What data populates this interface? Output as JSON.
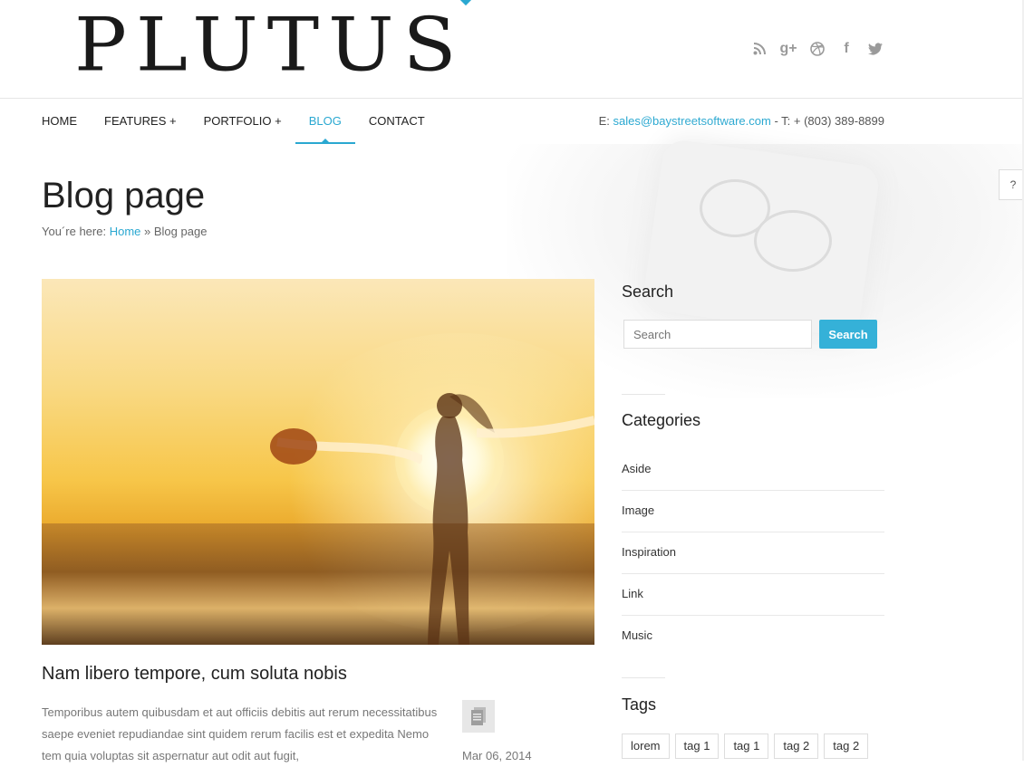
{
  "brand": {
    "logo_text": "PLUTUS"
  },
  "social": [
    {
      "icon": "rss-icon",
      "glyph": "◌"
    },
    {
      "icon": "google-plus-icon",
      "glyph": "g+"
    },
    {
      "icon": "dribbble-icon",
      "glyph": "◎"
    },
    {
      "icon": "facebook-icon",
      "glyph": "f"
    },
    {
      "icon": "twitter-icon",
      "glyph": "✶"
    }
  ],
  "nav": {
    "items": [
      "HOME",
      "FEATURES +",
      "PORTFOLIO +",
      "BLOG",
      "CONTACT"
    ],
    "active": "BLOG"
  },
  "contact": {
    "email_prefix": "E:",
    "email": "sales@baystreetsoftware.com",
    "phone": " - T: + (803) 389-8899"
  },
  "help_tab": "?",
  "page": {
    "title": "Blog page",
    "breadcrumb_prefix": "You´re here:",
    "breadcrumb_home": "Home",
    "breadcrumb_sep": "»",
    "breadcrumb_current": "Blog page"
  },
  "post": {
    "title": "Nam libero tempore, cum soluta nobis",
    "excerpt": "Temporibus autem quibusdam et aut officiis debitis aut rerum necessitatibus saepe eveniet repudiandae sint quidem rerum facilis est et expedita Nemo tem quia voluptas sit aspernatur aut odit aut fugit,",
    "date": "Mar 06, 2014",
    "format_icon": "document-icon"
  },
  "sidebar": {
    "search_title": "Search",
    "search_placeholder": "Search",
    "search_button": "Search",
    "categories_title": "Categories",
    "categories": [
      "Aside",
      "Image",
      "Inspiration",
      "Link",
      "Music"
    ],
    "tags_title": "Tags",
    "tags": [
      "lorem",
      "tag 1",
      "tag 1",
      "tag 2",
      "tag 2"
    ]
  },
  "colors": {
    "accent": "#2aa8d1",
    "button": "#35b1d8"
  }
}
